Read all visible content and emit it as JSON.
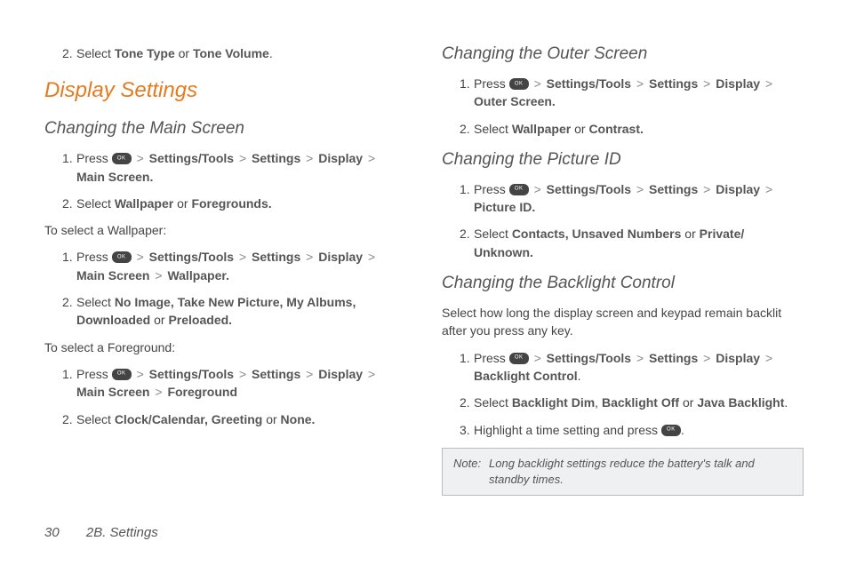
{
  "col1": {
    "topItem": {
      "num": "2.",
      "pre": "Select ",
      "b1": "Tone Type",
      "mid1": " or ",
      "b2": "Tone Volume",
      "post": "."
    },
    "h1": "Display Settings",
    "sec1": {
      "title": "Changing the Main Screen",
      "items": [
        {
          "num": "1.",
          "pre": "Press ",
          "path": [
            "Settings/Tools",
            "Settings",
            "Display",
            "Main Screen."
          ]
        },
        {
          "num": "2.",
          "pre": "Select ",
          "b1": "Wallpaper",
          "mid1": " or ",
          "b2": "Foregrounds.",
          "post": ""
        }
      ],
      "sub1Intro": "To select a Wallpaper:",
      "sub1Items": [
        {
          "num": "1.",
          "pre": "Press ",
          "path": [
            "Settings/Tools",
            "Settings",
            "Display",
            "Main Screen",
            "Wallpaper."
          ]
        },
        {
          "num": "2.",
          "pre": "Select ",
          "b1": "No Image, Take New Picture, My Albums, Downloaded",
          "mid1": " or ",
          "b2": "Preloaded.",
          "post": ""
        }
      ],
      "sub2Intro": "To select a Foreground:",
      "sub2Items": [
        {
          "num": "1.",
          "pre": "Press ",
          "path": [
            "Settings/Tools",
            "Settings",
            "Display",
            "Main Screen",
            "Foreground"
          ]
        },
        {
          "num": "2.",
          "pre": "Select ",
          "b1": "Clock/Calendar, Greeting",
          "mid1": " or ",
          "b2": "None.",
          "post": ""
        }
      ]
    }
  },
  "col2": {
    "sec1": {
      "title": "Changing the Outer Screen",
      "items": [
        {
          "num": "1.",
          "pre": "Press ",
          "path": [
            "Settings/Tools",
            "Settings",
            "Display",
            "Outer Screen."
          ]
        },
        {
          "num": "2.",
          "pre": "Select ",
          "b1": "Wallpaper",
          "mid1": " or ",
          "b2": "Contrast.",
          "post": ""
        }
      ]
    },
    "sec2": {
      "title": "Changing the Picture ID",
      "items": [
        {
          "num": "1.",
          "pre": "Press ",
          "path": [
            "Settings/Tools",
            "Settings",
            "Display",
            "Picture ID."
          ]
        },
        {
          "num": "2.",
          "pre": "Select ",
          "b1": "Contacts, Unsaved Numbers",
          "mid1": " or ",
          "b2": "Private/ Unknown.",
          "post": ""
        }
      ]
    },
    "sec3": {
      "title": "Changing the Backlight Control",
      "intro": "Select how long the display screen and keypad remain backlit after you press any key.",
      "items": [
        {
          "num": "1.",
          "pre": "Press ",
          "path": [
            "Settings/Tools",
            "Settings",
            "Display",
            "Backlight Control"
          ],
          "tail": "."
        },
        {
          "num": "2.",
          "pre": "Select ",
          "b1": "Backlight Dim",
          "mid1": ", ",
          "b2": "Backlight Off",
          "mid2": " or ",
          "b3": "Java Backlight",
          "post": "."
        },
        {
          "num": "3.",
          "pre": "Highlight a time setting and press ",
          "okAfter": true,
          "post": "."
        }
      ],
      "note": {
        "label": "Note:",
        "text": "Long backlight settings reduce the battery's talk and standby times."
      }
    }
  },
  "footer": {
    "page": "30",
    "section": "2B. Settings"
  }
}
